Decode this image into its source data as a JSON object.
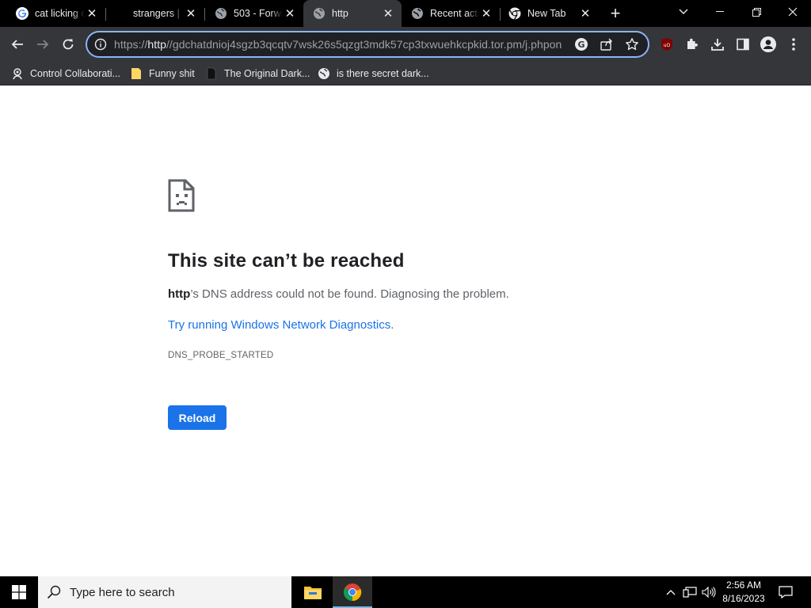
{
  "tabs": [
    {
      "title": "cat licking c",
      "icon": "google-icon",
      "active": false
    },
    {
      "title": "strangers | ",
      "icon": "none",
      "active": false
    },
    {
      "title": "503 - Forwa",
      "icon": "globe-icon",
      "active": false
    },
    {
      "title": "http",
      "icon": "globe-icon",
      "active": true
    },
    {
      "title": "Recent acti",
      "icon": "globe-icon",
      "active": false
    },
    {
      "title": "New Tab",
      "icon": "chrome-icon",
      "active": false
    }
  ],
  "omnibox": {
    "scheme": "https://",
    "host": "http",
    "rest": "//gdchatdnioj4sgzb3qcqtv7wsk26s5qzgt3mdk57cp3txwuehkcpkid.tor.pm/j.phpon"
  },
  "bookmarks": [
    {
      "label": "Control Collaborati...",
      "icon": "bookmark-app-icon"
    },
    {
      "label": "Funny shit",
      "icon": "folder-icon"
    },
    {
      "label": "The Original Dark...",
      "icon": "page-icon"
    },
    {
      "label": "is there secret dark...",
      "icon": "globe-icon"
    }
  ],
  "error": {
    "title": "This site can’t be reached",
    "host": "http",
    "desc_suffix": "’s DNS address could not be found. Diagnosing the problem.",
    "link": "Try running Windows Network Diagnostics",
    "link_suffix": ".",
    "code": "DNS_PROBE_STARTED",
    "reload_label": "Reload"
  },
  "taskbar": {
    "search_placeholder": "Type here to search",
    "time": "2:56 AM",
    "date": "8/16/2023"
  },
  "colors": {
    "accent": "#1a73e8",
    "focus_ring": "#8ab4f8",
    "toolbar": "#35363a"
  }
}
